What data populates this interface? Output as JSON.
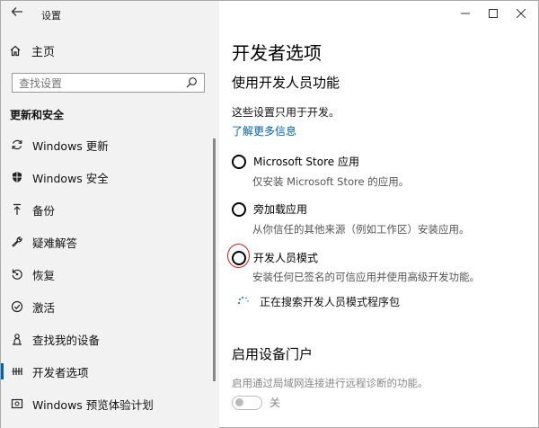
{
  "window": {
    "title": "设置"
  },
  "sidebar": {
    "home_label": "主页",
    "search_placeholder": "查找设置",
    "section_title": "更新和安全",
    "items": [
      {
        "label": "Windows 更新",
        "icon": "sync-icon"
      },
      {
        "label": "Windows 安全",
        "icon": "shield-icon"
      },
      {
        "label": "备份",
        "icon": "backup-arrow-icon"
      },
      {
        "label": "疑难解答",
        "icon": "wrench-icon"
      },
      {
        "label": "恢复",
        "icon": "recovery-icon"
      },
      {
        "label": "激活",
        "icon": "check-circle-icon"
      },
      {
        "label": "查找我的设备",
        "icon": "person-pin-icon"
      },
      {
        "label": "开发者选项",
        "icon": "developer-icon",
        "active": true
      },
      {
        "label": "Windows 预览体验计划",
        "icon": "insider-icon"
      }
    ]
  },
  "main": {
    "page_title": "开发者选项",
    "section1_title": "使用开发人员功能",
    "description": "这些设置只用于开发。",
    "learn_more_link": "了解更多信息",
    "options": [
      {
        "label": "Microsoft Store 应用",
        "sub": "仅安装 Microsoft Store 的应用。"
      },
      {
        "label": "旁加载应用",
        "sub": "从你信任的其他来源（例如工作区）安装应用。"
      },
      {
        "label": "开发人员模式",
        "sub": "安装任何已签名的可信应用并使用高级开发功能。"
      }
    ],
    "status_text": "正在搜索开发人员模式程序包",
    "section2_title": "启用设备门户",
    "section2_desc": "启用通过局域网连接进行远程诊断的功能。",
    "toggle_label": "关",
    "toggle_state": "off"
  },
  "colors": {
    "accent": "#0063b1",
    "annotation": "#e01818",
    "sidebar_bg": "#f2f2f2"
  }
}
